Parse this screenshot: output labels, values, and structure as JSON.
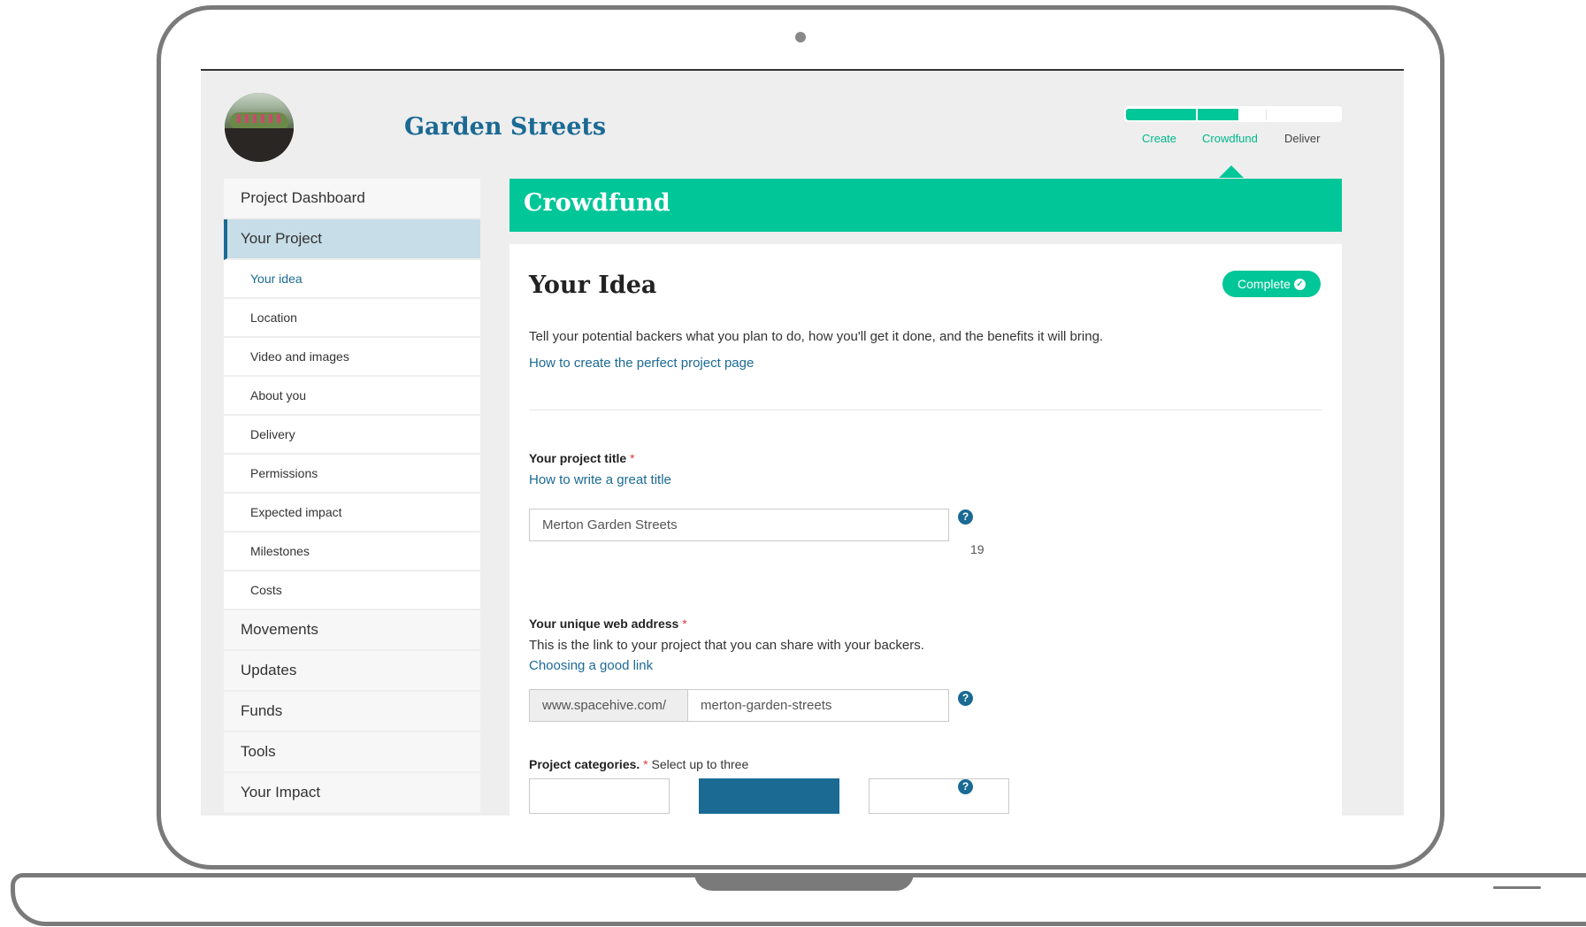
{
  "header": {
    "site_title": "Garden Streets",
    "steps": [
      "Create",
      "Crowdfund",
      "Deliver"
    ],
    "progress_stage": "Crowdfund"
  },
  "sidebar": {
    "top_items": [
      "Project Dashboard",
      "Your Project"
    ],
    "active_item": "Your Project",
    "sub_items": [
      "Your idea",
      "Location",
      "Video and images",
      "About you",
      "Delivery",
      "Permissions",
      "Expected impact",
      "Milestones",
      "Costs"
    ],
    "current_sub_item": "Your idea",
    "bottom_items": [
      "Movements",
      "Updates",
      "Funds",
      "Tools",
      "Your Impact"
    ]
  },
  "main": {
    "banner_title": "Crowdfund",
    "section_title": "Your Idea",
    "status_badge": "Complete",
    "intro_text": "Tell your potential backers what you plan to do, how you'll get it done, and the benefits it will bring.",
    "intro_link": "How to create the perfect project page",
    "title_field": {
      "label": "Your project title",
      "required_mark": "*",
      "help_link": "How to write a great title",
      "value": "Merton Garden Streets",
      "char_count": "19"
    },
    "web_address_field": {
      "label": "Your unique web address",
      "required_mark": "*",
      "description": "This is the link to your project that you can share with your backers.",
      "help_link": "Choosing a good link",
      "prefix": "www.spacehive.com/",
      "value": "merton-garden-streets"
    },
    "categories_field": {
      "label": "Project categories.",
      "required_mark": "*",
      "hint": "Select up to three"
    },
    "help_icon_glyph": "?"
  },
  "colors": {
    "accent_green": "#00c698",
    "brand_blue": "#1b6a94",
    "active_nav_bg": "#c7dde8",
    "required_red": "#e0393e"
  },
  "icons": [
    "help-icon",
    "check-circle-icon",
    "camera-dot"
  ]
}
